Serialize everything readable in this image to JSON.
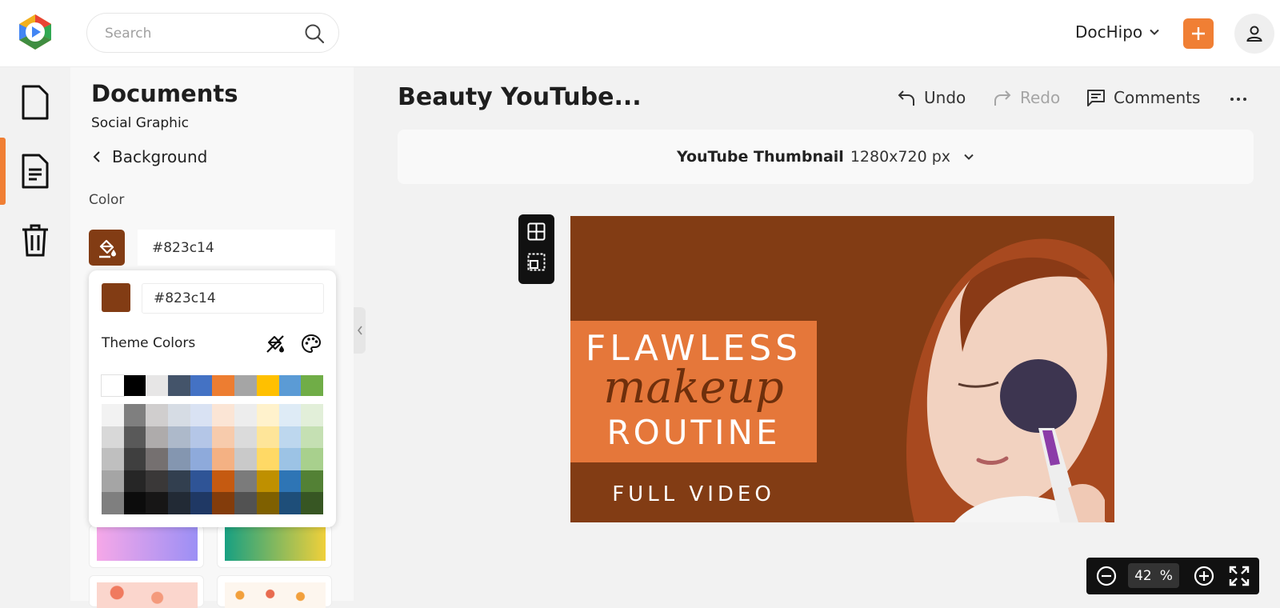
{
  "header": {
    "search_placeholder": "Search",
    "brand_label": "DocHipo",
    "accent_color": "#f07f34"
  },
  "sidebar": {
    "title": "Documents",
    "subtitle": "Social Graphic",
    "back_label": "Background",
    "color_label": "Color",
    "hex_value": "#823c14",
    "rail_items": [
      "file-icon",
      "document-icon",
      "trash-icon"
    ]
  },
  "color_picker": {
    "hex_value": "#823c14",
    "theme_label": "Theme Colors",
    "theme_colors": [
      "#ffffff",
      "#000000",
      "#e7e6e6",
      "#44546a",
      "#4472c4",
      "#ed7d31",
      "#a5a5a5",
      "#ffc000",
      "#5b9bd5",
      "#70ad47"
    ],
    "shades": [
      [
        "#f2f2f2",
        "#7f7f7f",
        "#d0cece",
        "#d6dce4",
        "#d9e2f3",
        "#fbe5d5",
        "#ededed",
        "#fff2cc",
        "#deebf6",
        "#e2efd9"
      ],
      [
        "#d8d8d8",
        "#595959",
        "#aeabab",
        "#adb9ca",
        "#b4c6e7",
        "#f7cbac",
        "#dbdbdb",
        "#fee599",
        "#bdd7ee",
        "#c5e0b3"
      ],
      [
        "#bfbfbf",
        "#3f3f3f",
        "#757070",
        "#8496b0",
        "#8eaadb",
        "#f4b183",
        "#c9c9c9",
        "#ffd965",
        "#9cc3e5",
        "#a8d08d"
      ],
      [
        "#a5a5a5",
        "#262626",
        "#3a3838",
        "#323f4f",
        "#2f5496",
        "#c55a11",
        "#7b7b7b",
        "#bf9000",
        "#2e75b5",
        "#538135"
      ],
      [
        "#7f7f7f",
        "#0c0c0c",
        "#171616",
        "#222a35",
        "#1f3864",
        "#833c0b",
        "#525252",
        "#7f6000",
        "#1e4e79",
        "#375623"
      ]
    ]
  },
  "editor": {
    "doc_title": "Beauty YouTube...",
    "undo_label": "Undo",
    "redo_label": "Redo",
    "comments_label": "Comments",
    "size_name": "YouTube Thumbnail",
    "size_dims": "1280x720 px",
    "zoom_value": "42",
    "zoom_unit": "%"
  },
  "thumbnail": {
    "background": "#823c14",
    "line1": "FLAWLESS",
    "line2": "makeup",
    "line3": "ROUTINE",
    "line4": "FULL VIDEO"
  }
}
